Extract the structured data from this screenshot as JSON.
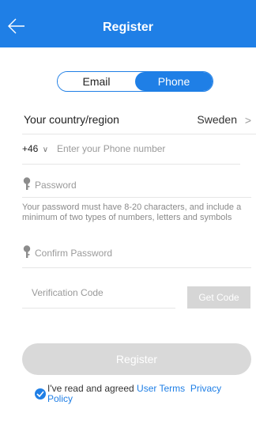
{
  "header": {
    "title": "Register",
    "back_icon": "arrow-left-icon"
  },
  "tabs": {
    "email_label": "Email",
    "phone_label": "Phone",
    "selected": "Phone"
  },
  "country": {
    "label": "Your country/region",
    "value": "Sweden",
    "chevron": ">"
  },
  "phone": {
    "code": "+46",
    "caret": "∨",
    "placeholder": "Enter your Phone number"
  },
  "password": {
    "placeholder": "Password",
    "icon": "key-icon"
  },
  "password_hint": "Your password must have 8-20 characters, and include a minimum of two types of numbers, letters and symbols",
  "confirm_password": {
    "placeholder": "Confirm Password",
    "icon": "key-icon"
  },
  "verification": {
    "placeholder": "Verification Code",
    "button_label": "Get Code"
  },
  "register_button": "Register",
  "agreement": {
    "prefix": "I've read and agreed ",
    "terms": "User Terms",
    "privacy": "Privacy Policy",
    "checked": true
  },
  "colors": {
    "accent": "#1f7fe6",
    "disabled": "#d9d9d9"
  }
}
